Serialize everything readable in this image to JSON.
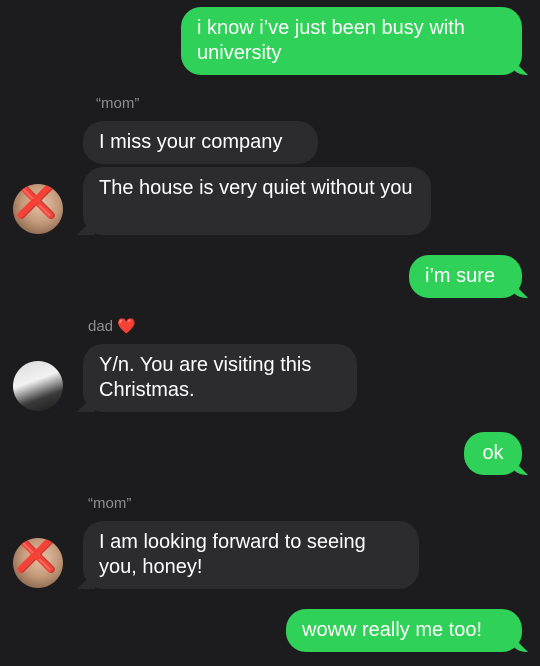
{
  "messages": {
    "m1": "i know i’ve just been busy with university",
    "m2": "I miss your company",
    "m3": "The house is very quiet without you",
    "m4": "i’m sure",
    "m5": "Y/n. You are visiting this Christmas.",
    "m6": "ok",
    "m7": "I am looking forward to seeing you, honey!",
    "m8": "woww really me too!"
  },
  "senders": {
    "mom1": "“mom”",
    "dad": "dad",
    "dad_emoji": "❤️",
    "mom2": "“mom”"
  },
  "icons": {
    "mom_avatar_mark": "❌"
  },
  "colors": {
    "background": "#1c1c1e",
    "outgoing": "#30d158",
    "incoming": "#2c2c2e",
    "sender_label": "#8e8e93"
  }
}
